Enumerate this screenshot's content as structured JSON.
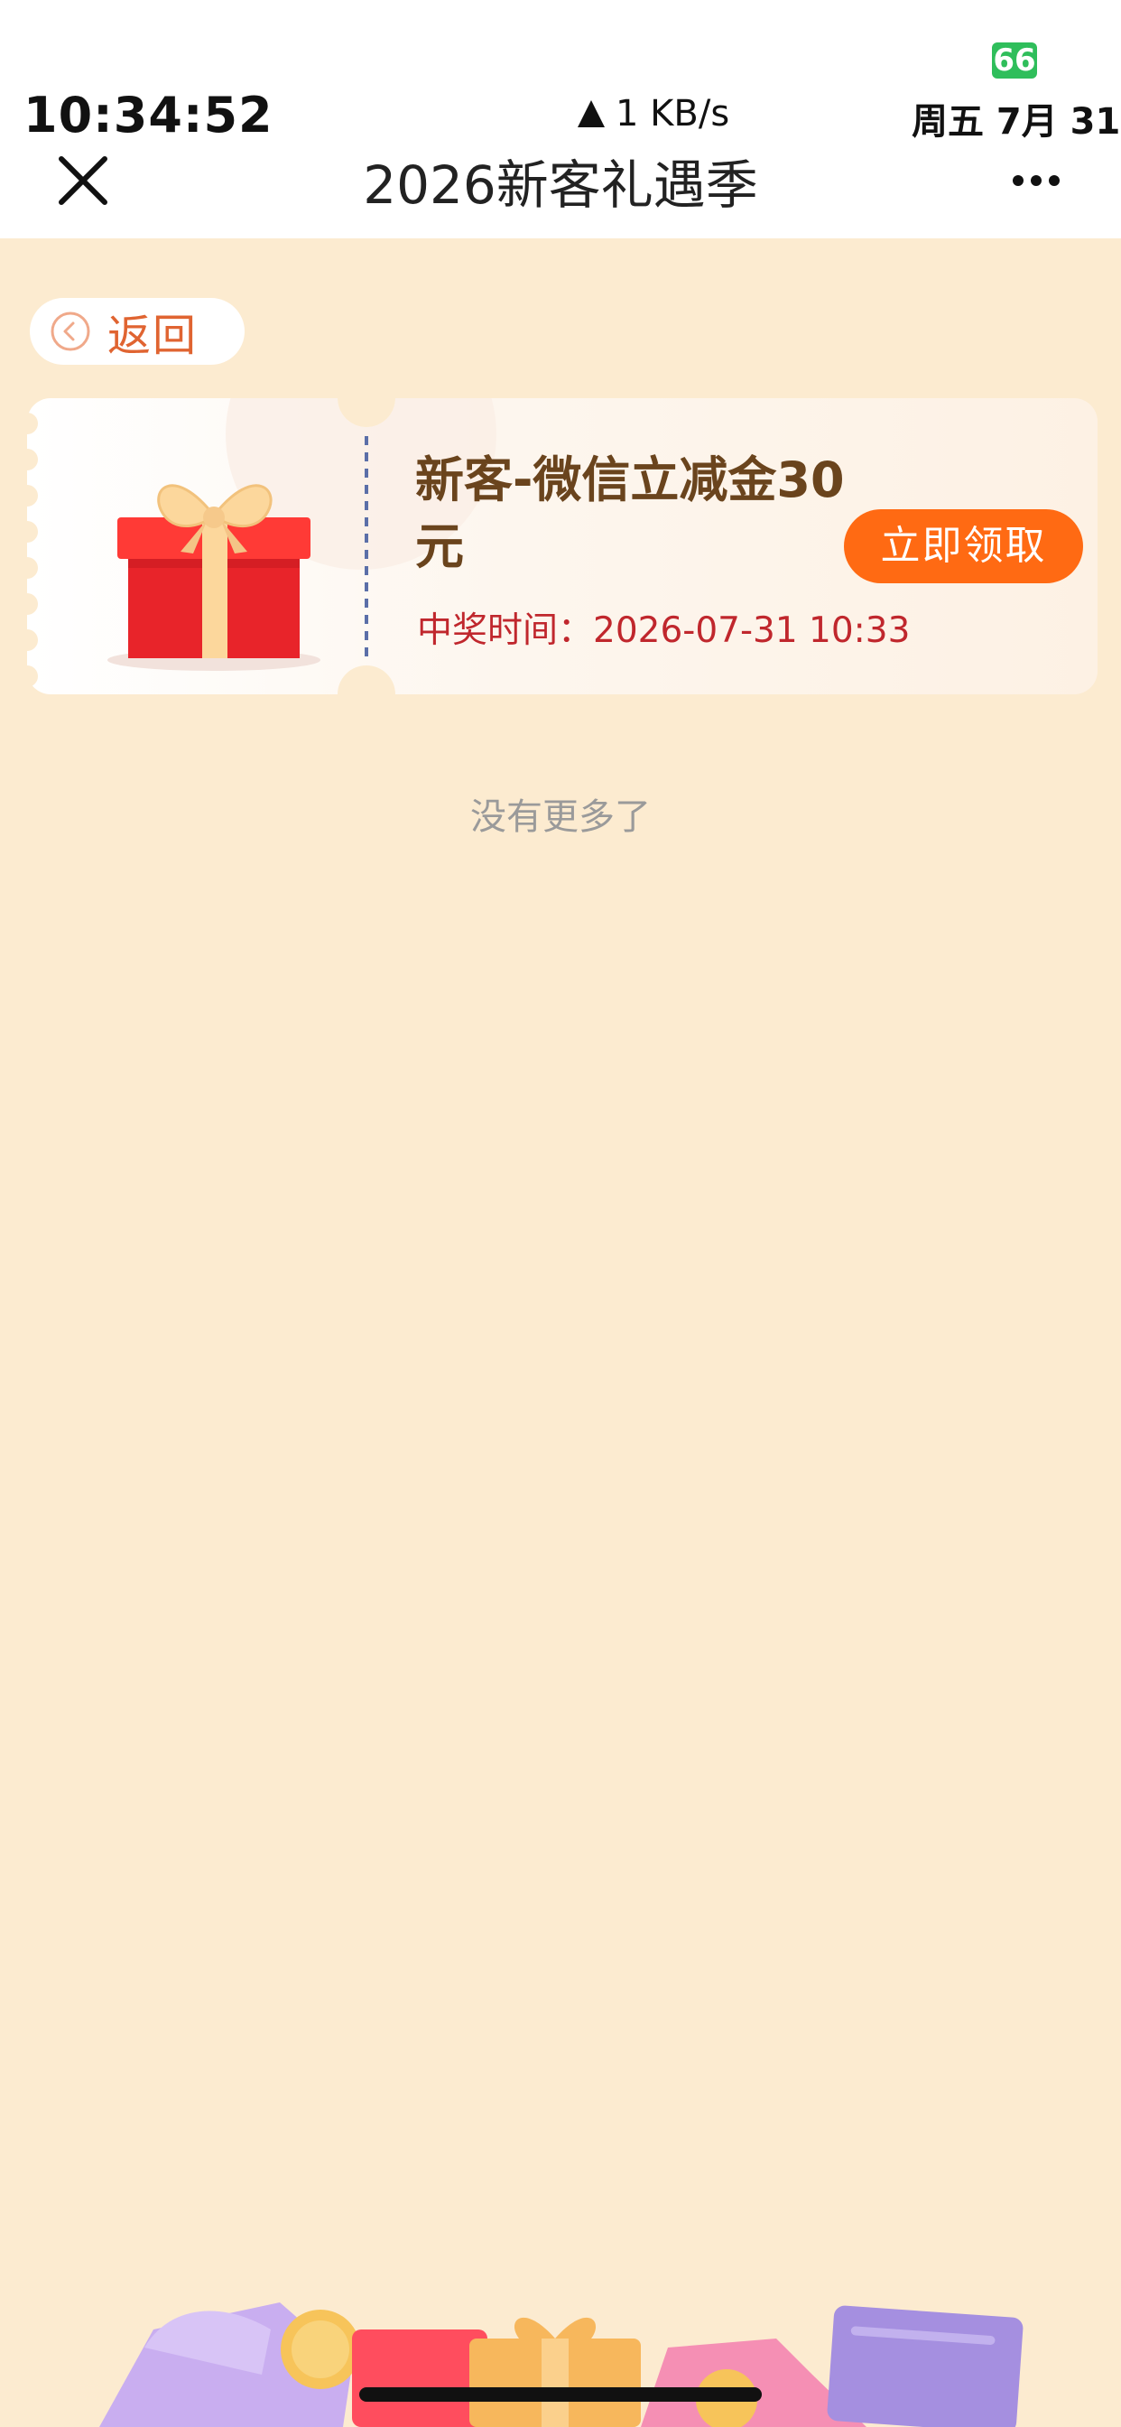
{
  "status_bar": {
    "time": "10:34:52",
    "battery": "66",
    "net_speed": "1 KB/s",
    "date": "周五 7月 31"
  },
  "nav": {
    "title": "2026新客礼遇季",
    "close_icon": "close-icon",
    "more_icon": "more-icon"
  },
  "back": {
    "label": "返回",
    "icon": "chevron-left-circle-icon"
  },
  "coupon": {
    "title": "新客-微信立减金30元",
    "time_label": "中奖时间：2026-07-31 10:33",
    "button_label": "立即领取",
    "image": "gift-box"
  },
  "list_end": "没有更多了",
  "colors": {
    "background": "#FCEBD0",
    "accent": "#FF6A13",
    "title_brown": "#6A441D",
    "time_red": "#C0272D"
  }
}
